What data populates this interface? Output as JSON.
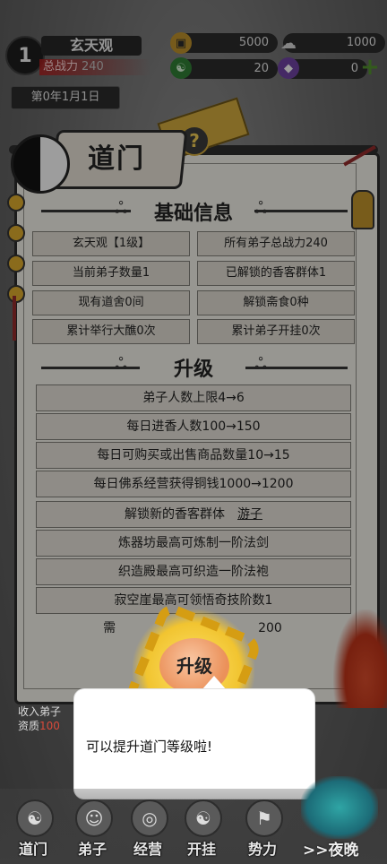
{
  "player": {
    "level": "1",
    "name": "玄天观",
    "power_label": "总战力",
    "power_value": "240",
    "date": "第0年1月1日"
  },
  "resources": [
    {
      "icon": "copper-coin-icon",
      "value": "5000"
    },
    {
      "icon": "incense-cloud-icon",
      "value": "1000"
    },
    {
      "icon": "green-jade-icon",
      "value": "20"
    },
    {
      "icon": "purple-gem-icon",
      "value": "0"
    }
  ],
  "panel": {
    "title": "道门",
    "help": "?",
    "section_basic": "基础信息",
    "basic_info": [
      "玄天观【1级】",
      "所有弟子总战力240",
      "当前弟子数量1",
      "已解锁的香客群体1",
      "现有道舍0间",
      "解锁斋食0种",
      "累计举行大醮0次",
      "累计弟子开挂0次"
    ],
    "section_upgrade": "升级",
    "upgrades": [
      "弟子人数上限4→6",
      "每日进香人数100→150",
      "每日可购买或出售商品数量10→15",
      "每日佛系经营获得铜钱1000→1200",
      "解锁新的香客群体",
      "炼器坊最高可炼制一阶法剑",
      "织造殿最高可织造一阶法袍",
      "寂空崖最高可领悟奇技阶数1"
    ],
    "upgrade_link": "游子",
    "requirement_left": "需",
    "requirement_right": "200",
    "upgrade_button": "升级"
  },
  "bottom_info": {
    "line1": "收入弟子",
    "line2_prefix": "资质",
    "line2_value": "100"
  },
  "tooltip": {
    "text": "可以提升道门等级啦!"
  },
  "nav": {
    "items": [
      "道门",
      "弟子",
      "经营",
      "开挂",
      "势力"
    ],
    "night": ">>夜晚"
  },
  "colors": {
    "panel_bg": "#e9e6df",
    "cell_bg": "#d7d3ca",
    "button": "#eb915a",
    "glow": "#f1c430",
    "accent_red": "#8e2a2a"
  }
}
